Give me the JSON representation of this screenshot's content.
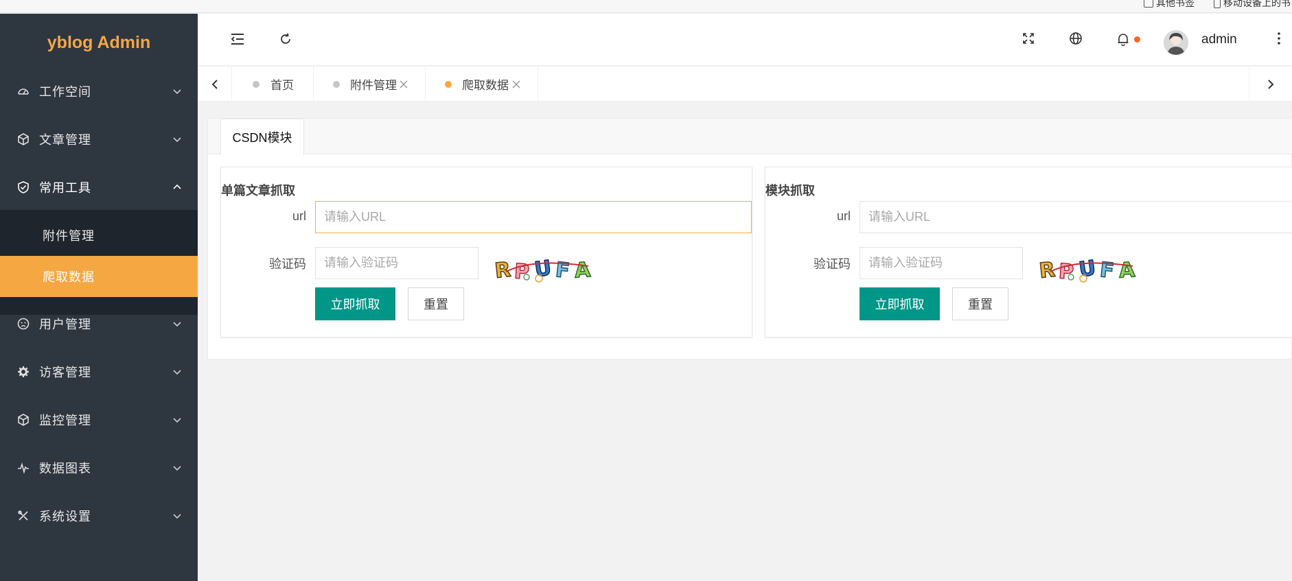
{
  "bookmarks": {
    "other": "其他书签",
    "mobile": "移动设备上的书"
  },
  "sidebar": {
    "logo": "yblog Admin",
    "menu": [
      {
        "label": "工作空间",
        "icon": "dashboard-icon"
      },
      {
        "label": "文章管理",
        "icon": "cube-icon"
      },
      {
        "label": "常用工具",
        "icon": "shield-check-icon"
      },
      {
        "label": "用户管理",
        "icon": "face-icon"
      },
      {
        "label": "访客管理",
        "icon": "gear-icon"
      },
      {
        "label": "监控管理",
        "icon": "cube-icon"
      },
      {
        "label": "数据图表",
        "icon": "pulse-icon"
      },
      {
        "label": "系统设置",
        "icon": "tools-icon"
      }
    ],
    "submenu": [
      {
        "label": "附件管理"
      },
      {
        "label": "爬取数据"
      }
    ]
  },
  "header": {
    "username": "admin"
  },
  "tabs": [
    {
      "label": "首页"
    },
    {
      "label": "附件管理"
    },
    {
      "label": "爬取数据"
    }
  ],
  "card": {
    "tab_label": "CSDN模块"
  },
  "panels": [
    {
      "title": "单篇文章抓取",
      "url_label": "url",
      "url_placeholder": "请输入URL",
      "captcha_label": "验证码",
      "captcha_placeholder": "请输入验证码",
      "captcha_text": "RPUFA",
      "submit_label": "立即抓取",
      "reset_label": "重置"
    },
    {
      "title": "模块抓取",
      "url_label": "url",
      "url_placeholder": "请输入URL",
      "captcha_label": "验证码",
      "captcha_placeholder": "请输入验证码",
      "captcha_text": "RPUFA",
      "submit_label": "立即抓取",
      "reset_label": "重置"
    }
  ],
  "colors": {
    "sidebar_bg": "#2e3640",
    "submenu_bg": "#1f252c",
    "accent": "#f5a742",
    "primary_button": "#009688",
    "notify_dot": "#f5662a"
  }
}
